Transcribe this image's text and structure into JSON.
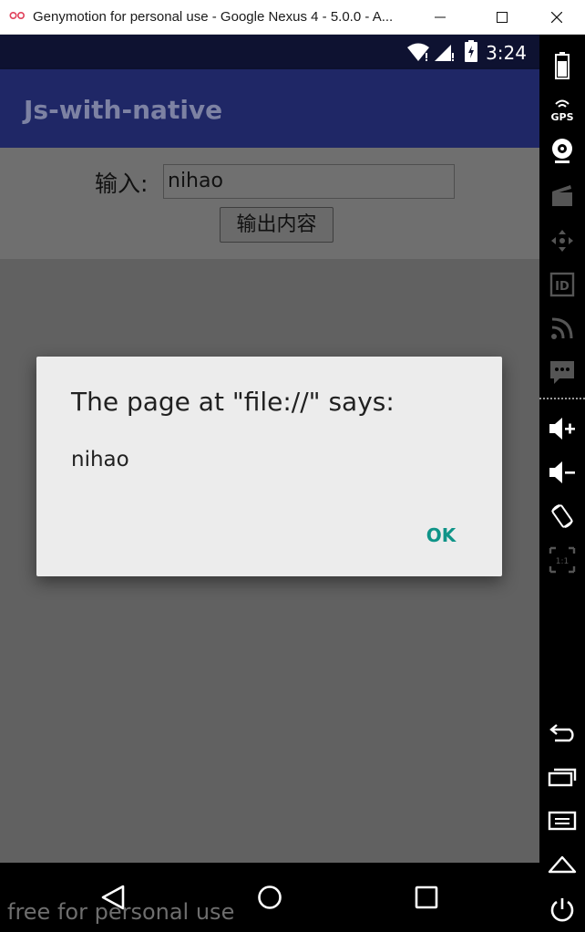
{
  "window": {
    "title": "Genymotion for personal use - Google Nexus 4 - 5.0.0 - A..."
  },
  "status_bar": {
    "time": "3:24"
  },
  "app": {
    "title": "Js-with-native"
  },
  "form": {
    "input_label": "输入:",
    "input_value": "nihao",
    "button_label": "输出内容"
  },
  "dialog": {
    "title": "The page at \"file://\" says:",
    "message": "nihao",
    "ok_label": "OK"
  },
  "navbar": {
    "watermark": "free for personal use",
    "icons": [
      "back-icon",
      "home-icon",
      "recent-apps-icon"
    ]
  },
  "side_panel": {
    "icons": [
      "battery-icon",
      "gps-icon",
      "webcam-icon",
      "video-capture-icon",
      "remote-control-icon",
      "device-id-icon",
      "network-icon",
      "sms-icon",
      "volume-up-icon",
      "volume-down-icon",
      "rotate-icon",
      "pixel-perfect-icon",
      "back-icon",
      "recent-apps-icon",
      "menu-icon",
      "home-icon",
      "power-icon"
    ]
  },
  "colors": {
    "action_bar": "#1f2766",
    "status_bar": "#0e1231",
    "dialog_accent": "#0f9488",
    "scrim": "#616161"
  }
}
